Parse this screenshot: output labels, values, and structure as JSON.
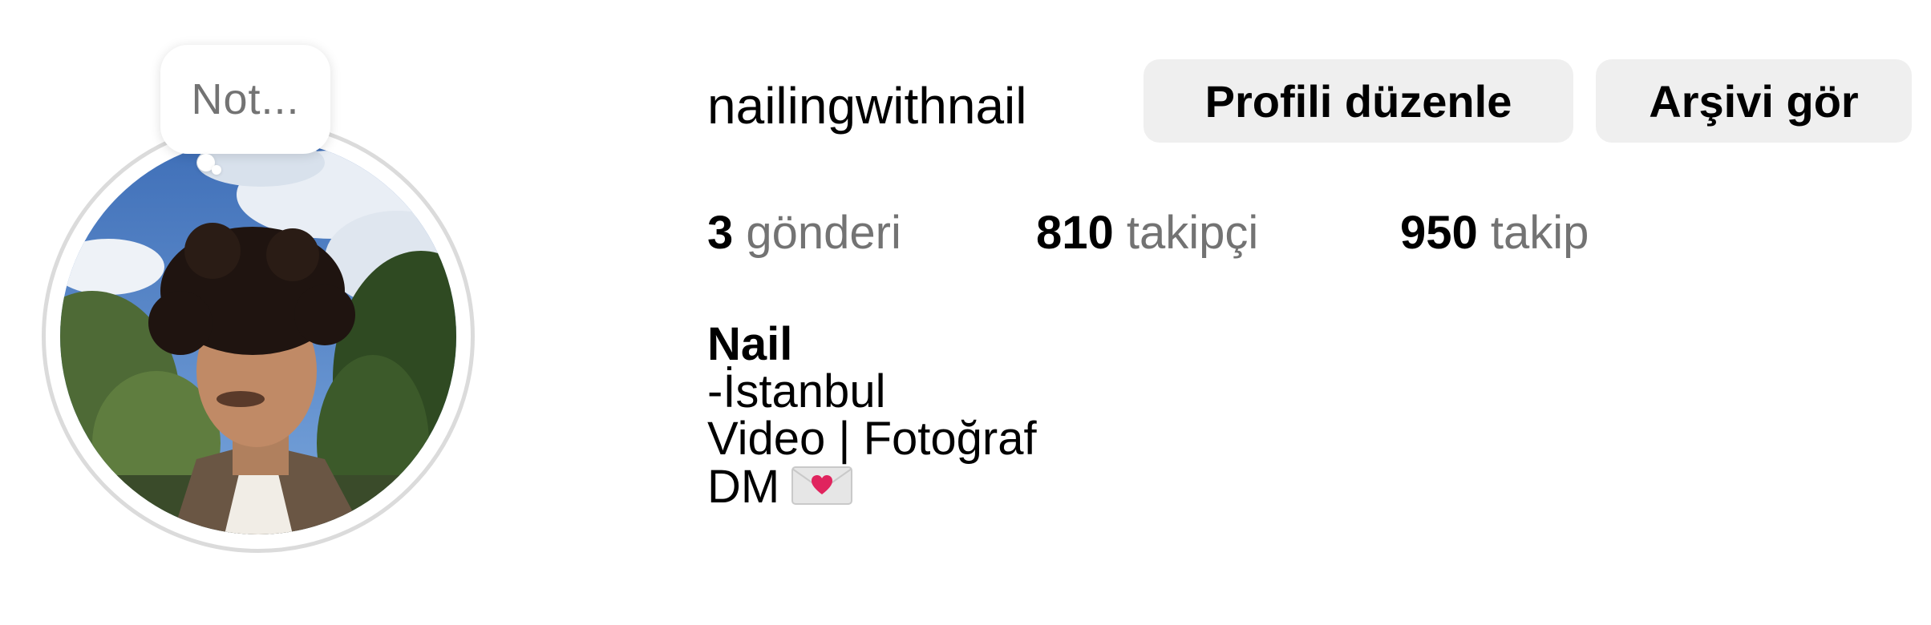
{
  "profile": {
    "username": "nailingwithnail",
    "note_placeholder": "Not...",
    "buttons": {
      "edit_profile": "Profili düzenle",
      "view_archive": "Arşivi gör"
    },
    "stats": {
      "posts": {
        "count": "3",
        "label": "gönderi"
      },
      "followers": {
        "count": "810",
        "label": "takipçi"
      },
      "following": {
        "count": "950",
        "label": "takip"
      }
    },
    "bio": {
      "name": "Nail",
      "lines": [
        "-İstanbul",
        "Video | Fotoğraf",
        "DM"
      ],
      "emoji": "envelope-with-heart-icon"
    }
  },
  "colors": {
    "secondary_text": "#737373",
    "button_bg": "#efefef",
    "avatar_ring": "#dbdbdb",
    "heart": "#e0245e"
  }
}
